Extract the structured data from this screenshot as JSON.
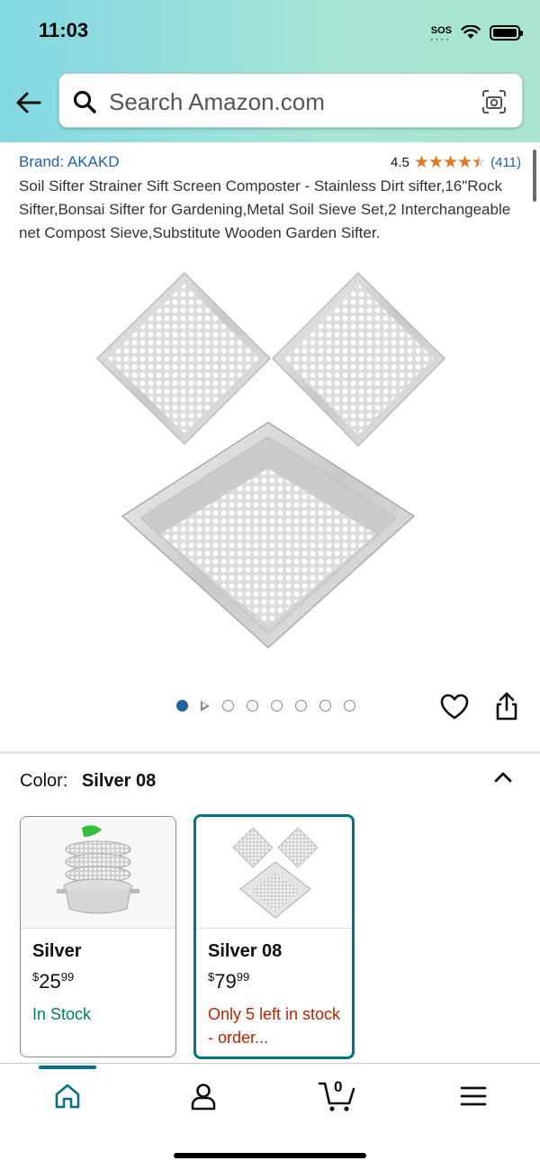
{
  "status_bar": {
    "time": "11:03",
    "sos": "SOS"
  },
  "search": {
    "placeholder": "Search Amazon.com"
  },
  "product": {
    "brand": "Brand: AKAKD",
    "rating_value": "4.5",
    "rating_stars": 4.5,
    "rating_count": "(411)",
    "title": "Soil Sifter Strainer Sift Screen Composter - Stainless Dirt sifter,16\"Rock Sifter,Bonsai Sifter for Gardening,Metal Soil Sieve Set,2 Interchangeable net Compost Sieve,Substitute Wooden Garden Sifter.",
    "image_count": 8,
    "active_image_index": 0
  },
  "variation": {
    "label": "Color:",
    "selected": "Silver 08",
    "options": [
      {
        "name": "Silver",
        "price_whole": "25",
        "price_fraction": "99",
        "currency": "$",
        "stock": "In Stock"
      },
      {
        "name": "Silver 08",
        "price_whole": "79",
        "price_fraction": "99",
        "currency": "$",
        "stock": "Only 5 left in stock - order..."
      }
    ]
  },
  "bottom_nav": {
    "items": [
      "home-icon",
      "account-icon",
      "cart-icon",
      "menu-icon"
    ],
    "cart_count": "0"
  },
  "colors": {
    "link": "#2162a1",
    "star": "#de7921",
    "in_stock": "#067d62",
    "low_stock": "#b12704",
    "accent": "#007185"
  }
}
